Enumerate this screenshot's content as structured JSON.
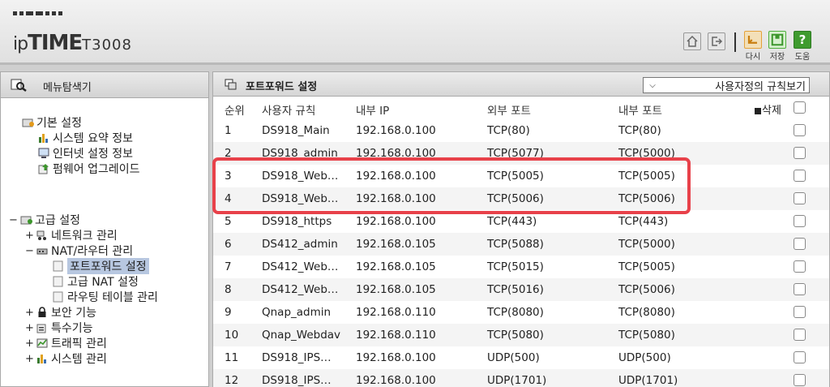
{
  "header": {
    "brand_ip": "ip",
    "brand_time": "TIME",
    "brand_model": "T3008",
    "buttons": [
      {
        "label": "다시",
        "icon": "undo-icon"
      },
      {
        "label": "저장",
        "icon": "save-icon"
      },
      {
        "label": "도움",
        "icon": "help-icon"
      }
    ],
    "help_glyph": "?"
  },
  "sidebar": {
    "title": "메뉴탐색기",
    "basic": {
      "label": "기본 설정",
      "items": [
        "시스템 요약 정보",
        "인터넷 설정 정보",
        "펌웨어 업그레이드"
      ]
    },
    "advanced": {
      "toggle": "−",
      "label": "고급 설정",
      "items": [
        {
          "toggle": "+",
          "label": "네트워크 관리"
        },
        {
          "toggle": "−",
          "label": "NAT/라우터 관리"
        },
        {
          "toggle": "+",
          "label": "보안 기능"
        },
        {
          "toggle": "+",
          "label": "특수기능"
        },
        {
          "toggle": "+",
          "label": "트래픽 관리"
        },
        {
          "toggle": "+",
          "label": "시스템 관리"
        }
      ],
      "nat_children": [
        "포트포워드 설정",
        "고급 NAT 설정",
        "라우팅 테이블 관리"
      ]
    }
  },
  "main": {
    "title": "포트포워드 설정",
    "rule_select": "사용자정의 규칙보기",
    "columns": [
      "순위",
      "사용자 규칙",
      "내부 IP",
      "외부 포트",
      "내부 포트",
      "삭제"
    ],
    "rows": [
      [
        "1",
        "DS918_Main",
        "192.168.0.100",
        "TCP(80)",
        "TCP(80)"
      ],
      [
        "2",
        "DS918_admin",
        "192.168.0.100",
        "TCP(5077)",
        "TCP(5000)"
      ],
      [
        "3",
        "DS918_Web…",
        "192.168.0.100",
        "TCP(5005)",
        "TCP(5005)"
      ],
      [
        "4",
        "DS918_Web…",
        "192.168.0.100",
        "TCP(5006)",
        "TCP(5006)"
      ],
      [
        "5",
        "DS918_https",
        "192.168.0.100",
        "TCP(443)",
        "TCP(443)"
      ],
      [
        "6",
        "DS412_admin",
        "192.168.0.105",
        "TCP(5088)",
        "TCP(5000)"
      ],
      [
        "7",
        "DS412_Web…",
        "192.168.0.105",
        "TCP(5015)",
        "TCP(5005)"
      ],
      [
        "8",
        "DS412_Web…",
        "192.168.0.105",
        "TCP(5016)",
        "TCP(5006)"
      ],
      [
        "9",
        "Qnap_admin",
        "192.168.0.110",
        "TCP(8080)",
        "TCP(8080)"
      ],
      [
        "10",
        "Qnap_Webdav",
        "192.168.0.110",
        "TCP(5080)",
        "TCP(5080)"
      ],
      [
        "11",
        "DS918_IPS…",
        "192.168.0.100",
        "UDP(500)",
        "UDP(500)"
      ],
      [
        "12",
        "DS918_IPS…",
        "192.168.0.100",
        "UDP(1701)",
        "UDP(1701)"
      ]
    ]
  },
  "colors": {
    "highlight": "#e8414a",
    "undo": "#e4a23a",
    "save": "#4caf3a",
    "help": "#3f9b2f"
  }
}
